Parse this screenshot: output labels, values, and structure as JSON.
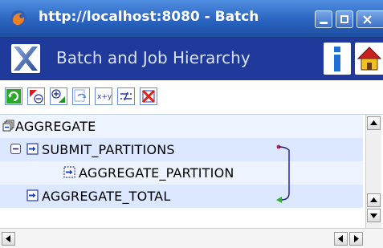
{
  "window": {
    "title": "http://localhost:8080 - Batch",
    "minimize_label": "_",
    "maximize_label": "□",
    "close_label": "×"
  },
  "header": {
    "title": "Batch and Job Hierarchy",
    "info_icon": "info-icon",
    "home_icon": "home-icon",
    "logo_icon": "x-logo-icon"
  },
  "toolbar": {
    "buttons": [
      {
        "name": "refresh-icon",
        "color": "#1a9a1a"
      },
      {
        "name": "collapse-icon",
        "color": "#d01010"
      },
      {
        "name": "expand-icon",
        "color": "#1a8a1a"
      },
      {
        "name": "redo-icon",
        "color": "#4a7ad0"
      },
      {
        "name": "xy-icon",
        "color": "#3050a0"
      },
      {
        "name": "flow-icon",
        "color": "#3050a0"
      },
      {
        "name": "delete-icon",
        "color": "#e02020"
      }
    ]
  },
  "tree": {
    "nodes": [
      {
        "label": "AGGREGATE",
        "level": 0
      },
      {
        "label": "SUBMIT_PARTITIONS",
        "level": 1,
        "expanded": true
      },
      {
        "label": "AGGREGATE_PARTITION",
        "level": 2
      },
      {
        "label": "AGGREGATE_TOTAL",
        "level": 1
      }
    ]
  },
  "colors": {
    "titlebar": "#2a64c0",
    "header": "#1f3a9b",
    "row_highlight": "#dbe8ff",
    "connector": "#2a2ab0"
  }
}
